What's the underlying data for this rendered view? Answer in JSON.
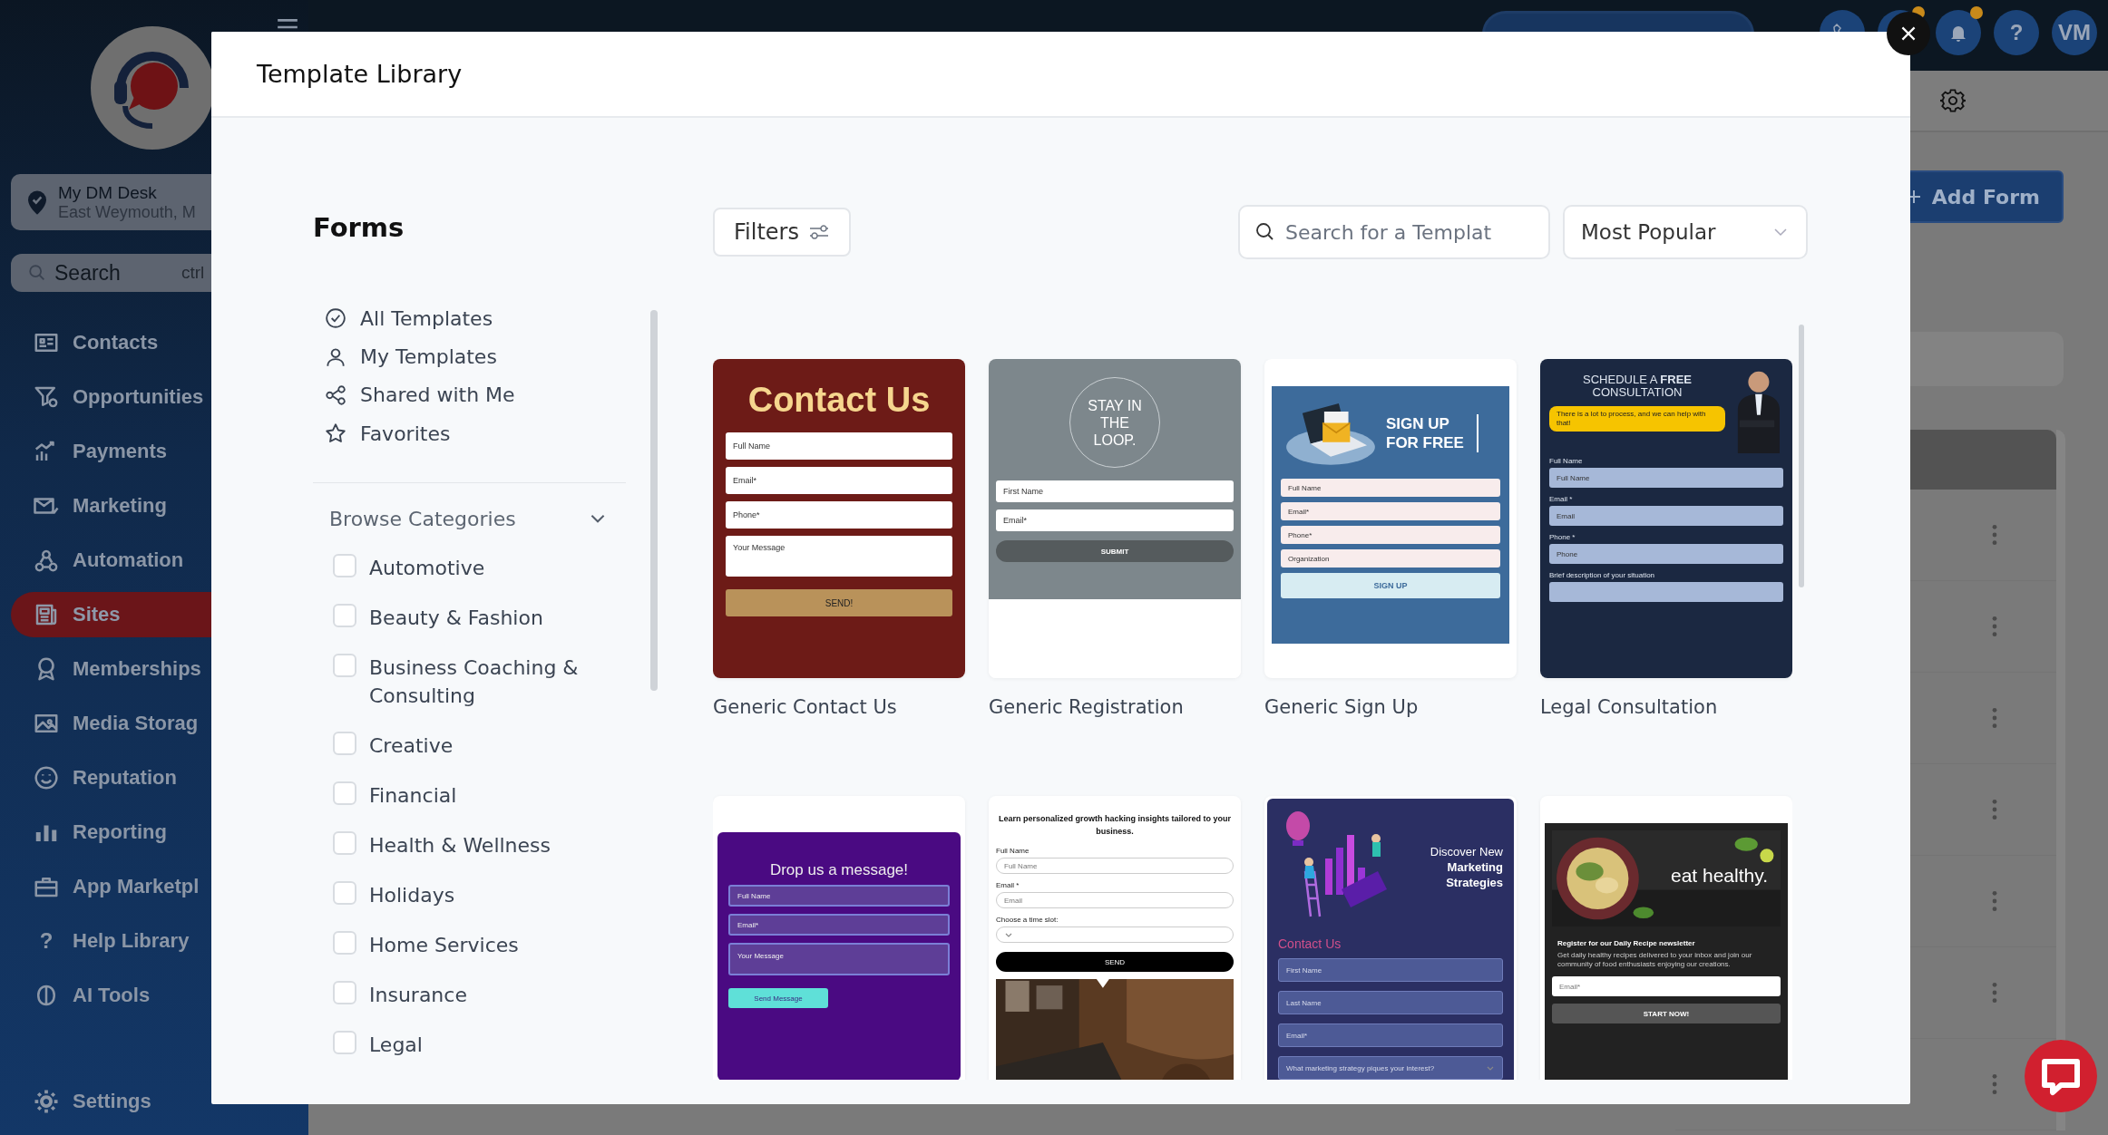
{
  "sidebar": {
    "location": {
      "name": "My DM Desk",
      "address": "East Weymouth, M"
    },
    "search": {
      "placeholder": "Search",
      "shortcut": "ctrl"
    },
    "items": [
      {
        "label": "Contacts",
        "selected": false
      },
      {
        "label": "Opportunities",
        "selected": false
      },
      {
        "label": "Payments",
        "selected": false
      },
      {
        "label": "Marketing",
        "selected": false
      },
      {
        "label": "Automation",
        "selected": false
      },
      {
        "label": "Sites",
        "selected": true
      },
      {
        "label": "Memberships",
        "selected": false
      },
      {
        "label": "Media Storag",
        "selected": false
      },
      {
        "label": "Reputation",
        "selected": false
      },
      {
        "label": "Reporting",
        "selected": false
      },
      {
        "label": "App Marketpl",
        "selected": false
      },
      {
        "label": "Help Library",
        "selected": false,
        "glyph": "?"
      },
      {
        "label": "AI Tools",
        "selected": false
      }
    ],
    "settings": "Settings"
  },
  "topbar": {
    "help": "?",
    "avatar": "VM"
  },
  "main": {
    "add_button": "Add Form"
  },
  "modal": {
    "title": "Template Library",
    "heading": "Forms",
    "nav": [
      {
        "label": "All Templates"
      },
      {
        "label": "My Templates"
      },
      {
        "label": "Shared with Me"
      },
      {
        "label": "Favorites"
      }
    ],
    "categories": {
      "title": "Browse Categories",
      "expanded": true,
      "items": [
        {
          "label": "Automotive",
          "checked": false
        },
        {
          "label": "Beauty & Fashion",
          "checked": false
        },
        {
          "label": "Business Coaching & Consulting",
          "checked": false
        },
        {
          "label": "Creative",
          "checked": false
        },
        {
          "label": "Financial",
          "checked": false
        },
        {
          "label": "Health & Wellness",
          "checked": false
        },
        {
          "label": "Holidays",
          "checked": false
        },
        {
          "label": "Home Services",
          "checked": false
        },
        {
          "label": "Insurance",
          "checked": false
        },
        {
          "label": "Legal",
          "checked": false
        }
      ]
    },
    "filters": "Filters",
    "search": {
      "placeholder": "Search for a Templat"
    },
    "sort": {
      "value": "Most Popular"
    },
    "cards": [
      {
        "title": "Generic Contact Us",
        "preview": {
          "kind": "contact",
          "heading": "Contact Us",
          "fields": [
            {
              "placeholder": "Full Name"
            },
            {
              "placeholder": "Email*"
            },
            {
              "placeholder": "Phone*"
            },
            {
              "placeholder": "Your Message",
              "kind": "area"
            }
          ],
          "button": "SEND!"
        }
      },
      {
        "title": "Generic Registration",
        "preview": {
          "kind": "loop",
          "heading": "STAY IN THE LOOP.",
          "fields": [
            {
              "placeholder": "First Name"
            },
            {
              "placeholder": "Email*"
            }
          ],
          "button": "SUBMIT"
        }
      },
      {
        "title": "Generic Sign Up",
        "preview": {
          "kind": "signup",
          "heading": "SIGN UP FOR FREE",
          "fields": [
            {
              "placeholder": "Full Name"
            },
            {
              "placeholder": "Email*"
            },
            {
              "placeholder": "Phone*"
            },
            {
              "placeholder": "Organization"
            }
          ],
          "button": "SIGN UP"
        }
      },
      {
        "title": "Legal Consultation",
        "preview": {
          "kind": "legal",
          "heading": "SCHEDULE A **FREE** CONSULTATION",
          "note": "There is a lot to process, and we can help with that!",
          "fields": [
            {
              "label": "Full Name",
              "placeholder": "Full Name"
            },
            {
              "label": "Email *",
              "placeholder": "Email"
            },
            {
              "label": "Phone *",
              "placeholder": "Phone"
            },
            {
              "label": "Brief description of your situation",
              "kind": "area"
            }
          ]
        }
      },
      {
        "preview": {
          "kind": "drop",
          "heading": "Drop us a message!",
          "fields": [
            {
              "placeholder": "Full Name"
            },
            {
              "placeholder": "Email*"
            },
            {
              "placeholder": "Your Message",
              "kind": "area"
            }
          ],
          "button": "Send Message"
        }
      },
      {
        "preview": {
          "kind": "growth",
          "heading": "Learn personalized growth hacking insights tailored to your business.",
          "fields": [
            {
              "label": "Full Name",
              "placeholder": "Full Name"
            },
            {
              "label": "Email *",
              "placeholder": "Email"
            },
            {
              "label": "Choose a time slot:",
              "kind": "select"
            }
          ],
          "button": "SEND"
        }
      },
      {
        "preview": {
          "kind": "marketing",
          "heading": "Discover New **Marketing Strategies**",
          "subheading": "Contact Us",
          "fields": [
            {
              "placeholder": "First Name"
            },
            {
              "placeholder": "Last Name"
            },
            {
              "placeholder": "Email*"
            },
            {
              "placeholder": "What marketing strategy piques your interest?",
              "kind": "select"
            }
          ]
        }
      },
      {
        "preview": {
          "kind": "healthy",
          "heading": "eat healthy.",
          "subheading": "Register for our Daily Recipe newsletter",
          "note": "Get daily healthy recipes delivered to your inbox and join our community of food enthusiasts enjoying our creations.",
          "fields": [
            {
              "placeholder": "Email*"
            }
          ],
          "button": "START NOW!"
        }
      }
    ]
  }
}
